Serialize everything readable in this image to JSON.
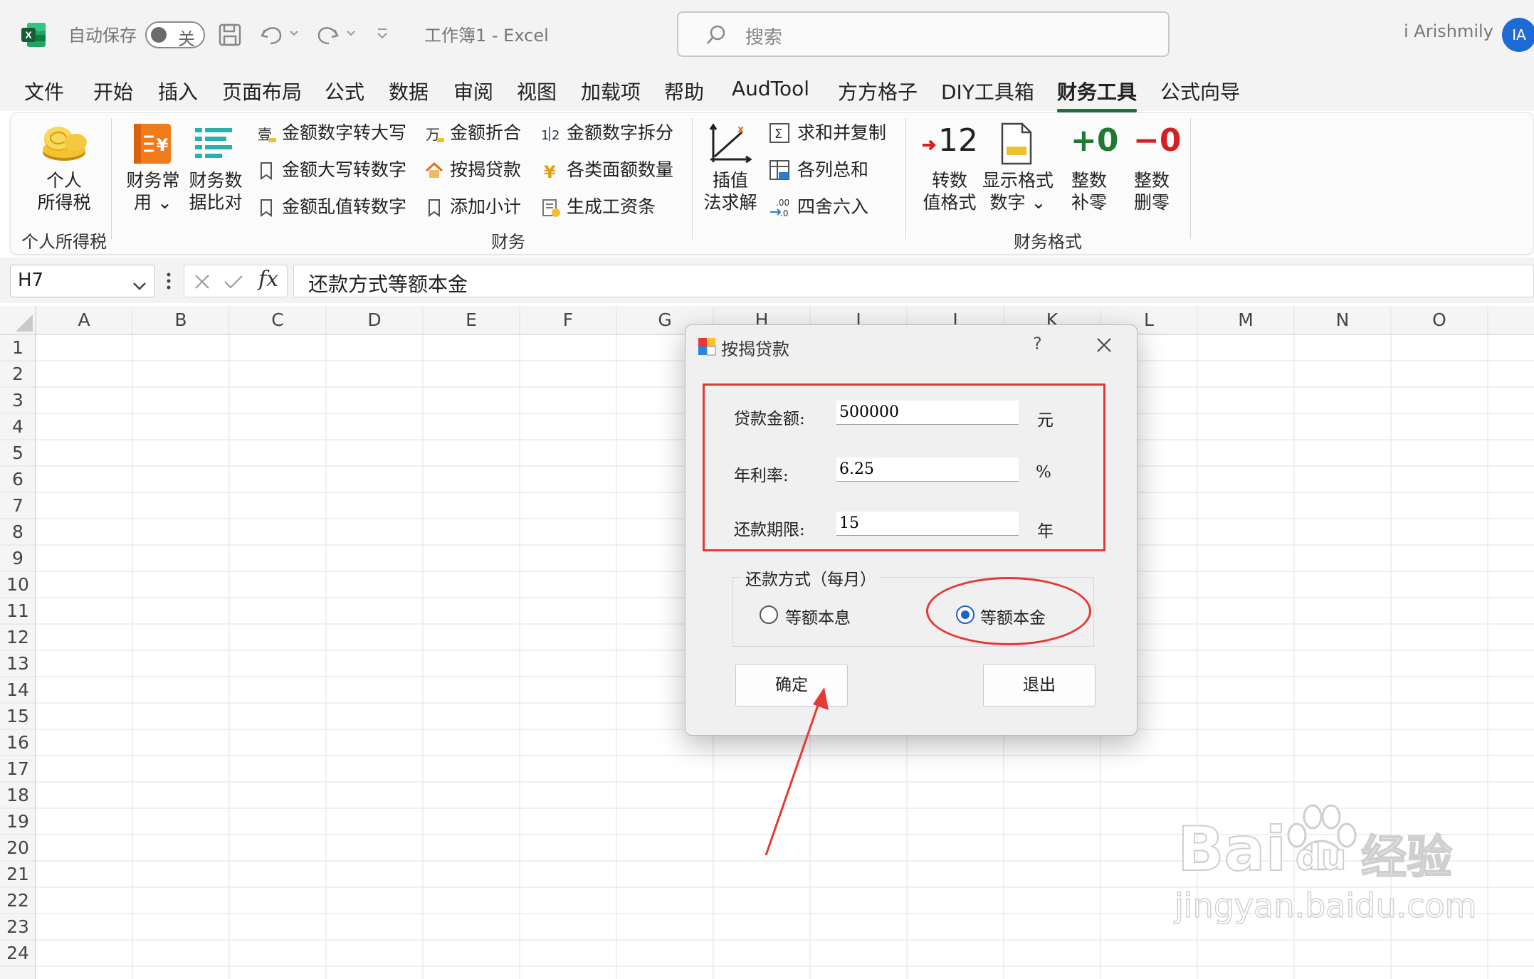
{
  "titlebar": {
    "autosave_label": "自动保存",
    "autosave_state": "关",
    "doc_title": "工作簿1  -  Excel",
    "search_placeholder": "搜索",
    "user_name": "i Arishmily",
    "avatar_initials": "IA"
  },
  "menu_tabs": [
    "文件",
    "开始",
    "插入",
    "页面布局",
    "公式",
    "数据",
    "审阅",
    "视图",
    "加载项",
    "帮助",
    "AudTool",
    "方方格子",
    "DIY工具箱",
    "财务工具",
    "公式向导"
  ],
  "active_tab": "财务工具",
  "ribbon": {
    "personal_tax": {
      "label_line1": "个人",
      "label_line2": "所得税",
      "group": "个人所得税"
    },
    "finance_common": {
      "line1": "财务常",
      "line2": "用 ⌄"
    },
    "finance_compare": {
      "line1": "财务数",
      "line2": "据比对"
    },
    "small_col1": [
      "金额数字转大写",
      "金额大写转数字",
      "金额乱值转数字"
    ],
    "small_col2": [
      "金额折合",
      "按揭贷款",
      "添加小计"
    ],
    "small_col3": [
      "金额数字拆分",
      "各类面额数量",
      "生成工资条"
    ],
    "finance_group": "财务",
    "interp": {
      "line1": "插值",
      "line2": "法求解"
    },
    "small_col4": [
      "求和并复制",
      "各列总和",
      "四舍六入"
    ],
    "fmt_buttons": [
      {
        "glyph": "12",
        "line1": "转数",
        "line2": "值格式"
      },
      {
        "glyph": "",
        "line1": "显示格式",
        "line2": "数字 ⌄"
      },
      {
        "glyph": "+0",
        "line1": "整数",
        "line2": "补零"
      },
      {
        "glyph": "−0",
        "line1": "整数",
        "line2": "删零"
      }
    ],
    "fmt_group": "财务格式"
  },
  "formula_bar": {
    "cell_ref": "H7",
    "formula": "还款方式等额本金"
  },
  "grid": {
    "columns": [
      "A",
      "B",
      "C",
      "D",
      "E",
      "F",
      "G",
      "H",
      "I",
      "J",
      "K",
      "L",
      "M",
      "N",
      "O"
    ],
    "rows": [
      "1",
      "2",
      "3",
      "4",
      "5",
      "6",
      "7",
      "8",
      "9",
      "10",
      "11",
      "12",
      "13",
      "14",
      "15",
      "16",
      "17",
      "18",
      "19",
      "20",
      "21",
      "22",
      "23",
      "24"
    ]
  },
  "dialog": {
    "title": "按揭贷款",
    "help": "?",
    "loan_amount_label": "贷款金额:",
    "loan_amount_value": "500000",
    "loan_amount_unit": "元",
    "rate_label": "年利率:",
    "rate_value": "6.25",
    "rate_unit": "%",
    "term_label": "还款期限:",
    "term_value": "15",
    "term_unit": "年",
    "method_legend": "还款方式（每月）",
    "option_equal_payment": "等额本息",
    "option_equal_principal": "等额本金",
    "selected_option": "等额本金",
    "confirm": "确定",
    "exit": "退出"
  },
  "watermark": {
    "brand": "Bai",
    "brand_tail": "du",
    "brand_cn": "经验",
    "url": "jingyan.baidu.com"
  },
  "colors": {
    "excel_green": "#1e7145",
    "accent_blue": "#1e5fcf",
    "annotation_red": "#e53935"
  }
}
